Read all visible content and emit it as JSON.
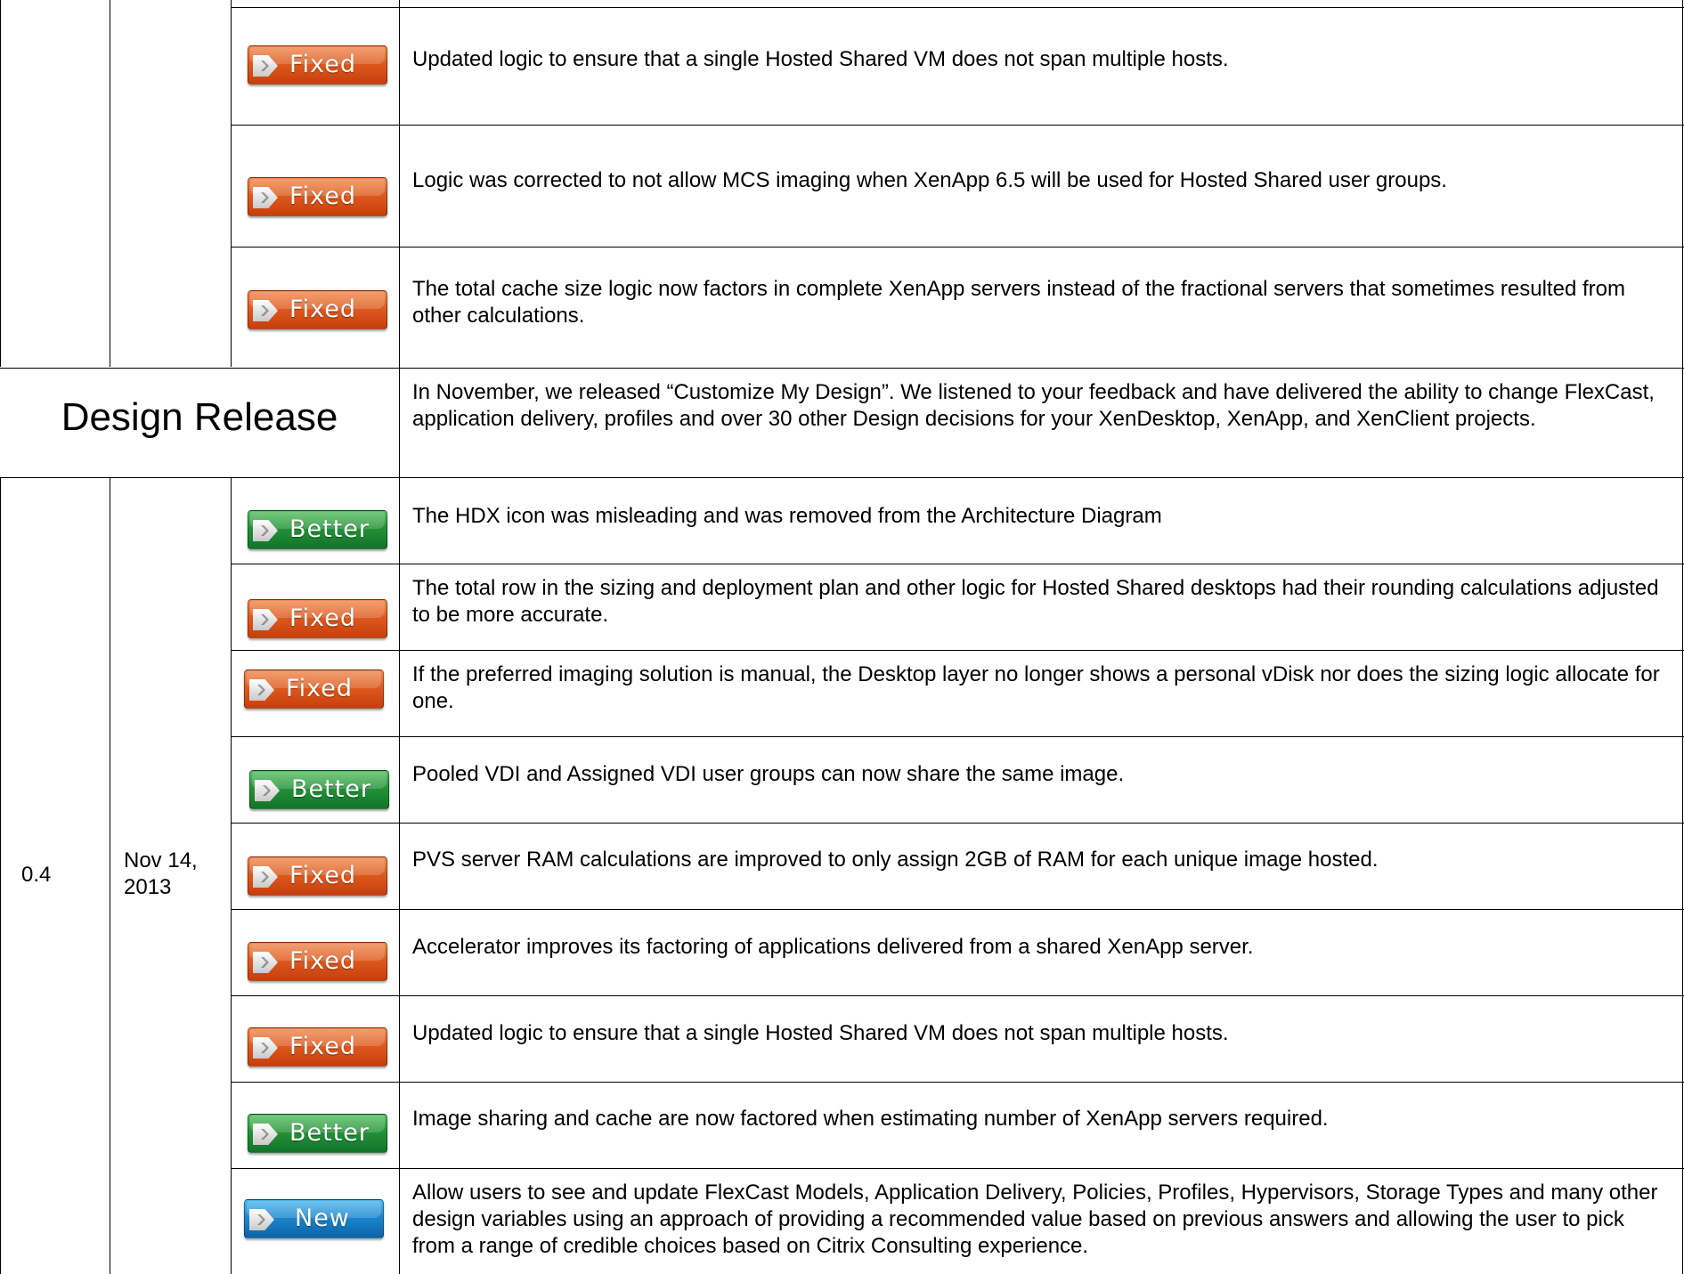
{
  "top_group": {
    "rows": [
      {
        "badge": "Fixed",
        "text": "Updated logic to ensure that a single Hosted Shared VM does not span multiple hosts."
      },
      {
        "badge": "Fixed",
        "text": "Logic was corrected to not allow MCS imaging when XenApp 6.5 will be used for Hosted Shared user groups."
      },
      {
        "badge": "Fixed",
        "text": "The total cache size logic now factors in complete XenApp servers instead of the fractional servers that sometimes resulted from other calculations."
      }
    ]
  },
  "design_release": {
    "title": "Design Release",
    "text": "In November, we released “Customize My Design”. We listened to your feedback and have delivered the ability to change FlexCast, application delivery, profiles and over 30 other Design decisions for your XenDesktop, XenApp, and XenClient projects."
  },
  "version_group": {
    "version": "0.4",
    "date_line1": "Nov 14,",
    "date_line2": "2013",
    "rows": [
      {
        "badge": "Better",
        "text": "The HDX icon was misleading and was removed from the Architecture Diagram"
      },
      {
        "badge": "Fixed",
        "text": "The total row in the sizing and deployment plan and other logic for Hosted Shared desktops had their rounding calculations adjusted to be more accurate."
      },
      {
        "badge": "Fixed",
        "text": "If the preferred imaging solution is manual, the Desktop layer no longer shows a personal vDisk nor does the sizing logic allocate for one."
      },
      {
        "badge": "Better",
        "text": "Pooled VDI and Assigned VDI user groups can now share the same image."
      },
      {
        "badge": "Fixed",
        "text": "PVS server RAM calculations are improved to only assign 2GB of RAM for each unique image hosted."
      },
      {
        "badge": "Fixed",
        "text": "Accelerator improves its factoring of applications delivered from a shared XenApp server."
      },
      {
        "badge": "Fixed",
        "text": "Updated logic to ensure that a single Hosted Shared VM does not span multiple hosts."
      },
      {
        "badge": "Better",
        "text": "Image sharing and cache are now factored when estimating number of XenApp servers required."
      },
      {
        "badge": "New",
        "text": "Allow users to see and update FlexCast Models, Application Delivery, Policies, Profiles, Hypervisors, Storage Types and many other design variables using an approach of providing a recommended value based on previous answers and allowing the user to pick from a range of credible choices  based on Citrix Consulting experience."
      }
    ]
  },
  "colors": {
    "fixed_badge": "#de5a1e",
    "better_badge": "#239237",
    "new_badge": "#1b87cf",
    "grid_lines": "#000000"
  }
}
